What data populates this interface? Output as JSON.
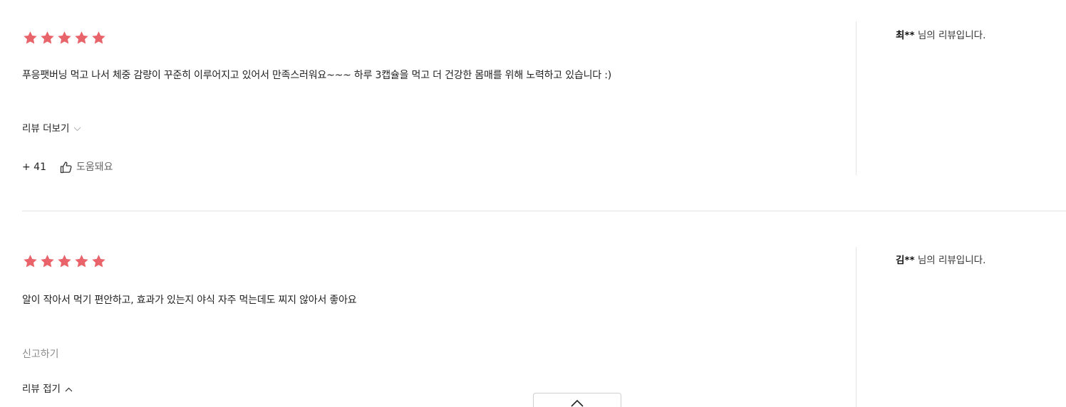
{
  "colors": {
    "star": "#e8636a",
    "text": "#222222",
    "muted": "#8c8c8c",
    "divider": "#e2e2e2"
  },
  "reviews": [
    {
      "rating": 5,
      "author_name": "최**",
      "author_suffix": " 님의 리뷰입니다.",
      "text": "푸응팻버닝 먹고 나서 체중 감량이 꾸준히 이루어지고 있어서 만족스러워요~~~ 하루 3캡슐을 먹고 더 건강한 몸매를 위해 노력하고 있습니다 :)",
      "toggle_label": "리뷰 더보기",
      "toggle_icon": "chevron-down-icon",
      "helpful_count": "+ 41",
      "helpful_label": "도움돼요",
      "helpful_icon": "thumbs-up-icon"
    },
    {
      "rating": 5,
      "author_name": "김**",
      "author_suffix": " 님의 리뷰입니다.",
      "text": "알이 작아서 먹기 편안하고, 효과가 있는지 야식 자주 먹는데도 찌지 않아서 좋아요",
      "report_label": "신고하기",
      "toggle_label": "리뷰 접기",
      "toggle_icon": "chevron-up-icon"
    }
  ],
  "scroll_top_icon": "chevron-up-icon"
}
